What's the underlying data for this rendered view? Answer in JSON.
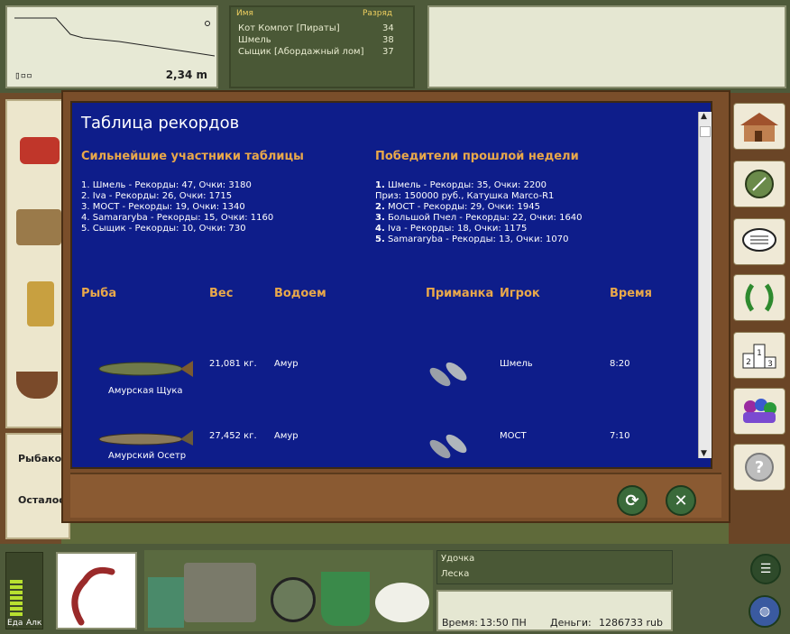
{
  "depth_panel": {
    "value": "2,34 m",
    "battery": "▯▫▫"
  },
  "players": {
    "col_name": "Имя",
    "col_rank": "Разряд",
    "rows": [
      {
        "name": "Кот Компот [Пираты]",
        "rank": "34"
      },
      {
        "name": "Шмель",
        "rank": "38"
      },
      {
        "name": "Сыщик [Абордажный лом]",
        "rank": "37"
      }
    ]
  },
  "left_panel": {
    "label1": "Рыбаков",
    "label2": "Осталос"
  },
  "records": {
    "title": "Таблица рекордов",
    "top_title": "Сильнейшие участники таблицы",
    "top": [
      "1. Шмель - Рекорды: 47, Очки: 3180",
      "2. Iva - Рекорды: 26, Очки: 1715",
      "3. МОСТ - Рекорды: 19, Очки: 1340",
      "4. Samararyba - Рекорды: 15, Очки: 1160",
      "5. Сыщик - Рекорды: 10, Очки: 730"
    ],
    "weekly_title": "Победители прошлой недели",
    "weekly": [
      {
        "num": "1.",
        "text": " Шмель - Рекорды: 35, Очки: 2200"
      },
      {
        "num": "",
        "text": "Приз: 150000 руб., Катушка Marco-R1"
      },
      {
        "num": "2.",
        "text": " МОСТ - Рекорды: 29, Очки: 1945"
      },
      {
        "num": "3.",
        "text": " Большой Пчел - Рекорды: 22, Очки: 1640"
      },
      {
        "num": "4.",
        "text": " Iva - Рекорды: 18, Очки: 1175"
      },
      {
        "num": "5.",
        "text": " Samararyba - Рекорды: 13, Очки: 1070"
      }
    ],
    "columns": {
      "fish": "Рыба",
      "weight": "Вес",
      "water": "Водоем",
      "bait": "Приманка",
      "player": "Игрок",
      "time": "Время"
    },
    "rows": [
      {
        "fish": "Амурская Щука",
        "weight": "21,081 кг.",
        "water": "Амур",
        "player": "Шмель",
        "time": "8:20"
      },
      {
        "fish": "Амурский Осетр",
        "weight": "27,452 кг.",
        "water": "Амур",
        "player": "МОСТ",
        "time": "7:10"
      }
    ]
  },
  "bottom": {
    "food_label": "Еда",
    "alc_label": "Алк",
    "rod_label": "Удочка",
    "line_label": "Леска",
    "time_label": "Время:",
    "time_value": "13:50 ПН",
    "money_label": "Деньги:",
    "money_value": "1286733 rub"
  },
  "colors": {
    "board": "#0e1d8a",
    "heading": "#e9a84a",
    "wood": "#7a4e2a"
  }
}
